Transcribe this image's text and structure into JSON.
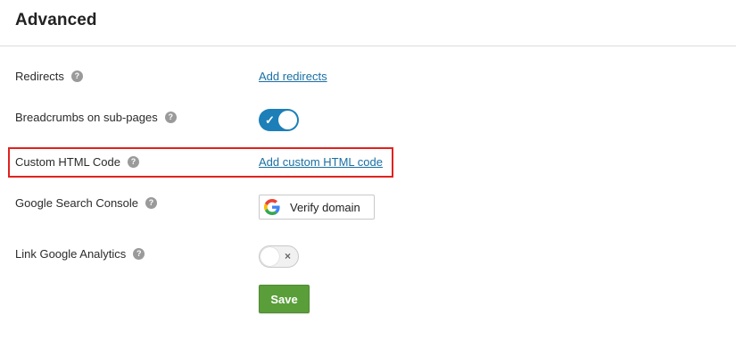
{
  "header": {
    "title": "Advanced"
  },
  "rows": {
    "redirects": {
      "label": "Redirects",
      "link": "Add redirects"
    },
    "breadcrumbs": {
      "label": "Breadcrumbs on sub-pages",
      "toggle_on": true,
      "toggle_glyph": "✓"
    },
    "custom_html": {
      "label": "Custom HTML Code",
      "link": "Add custom HTML code",
      "highlight_color": "#e0231e"
    },
    "search_console": {
      "label": "Google Search Console",
      "button_label": "Verify domain",
      "button_icon": "google-g-icon"
    },
    "analytics": {
      "label": "Link Google Analytics",
      "toggle_on": false,
      "toggle_glyph": "×"
    }
  },
  "help_glyph": "?",
  "actions": {
    "save_label": "Save"
  },
  "colors": {
    "accent": "#1c7fb8",
    "link": "#1a6fa3",
    "save": "#5a9e3a"
  }
}
